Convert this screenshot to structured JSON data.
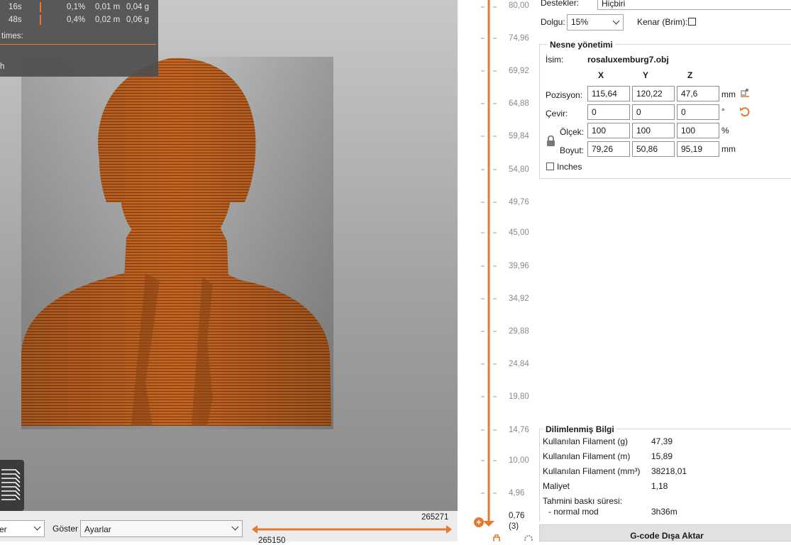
{
  "stats": {
    "rows": [
      {
        "time": "16s",
        "percent": "0,1%",
        "meters": "0,01 m",
        "grams": "0,04 g"
      },
      {
        "time": "48s",
        "percent": "0,4%",
        "meters": "0,02 m",
        "grams": "0,06 g"
      }
    ],
    "times_label": "times:",
    "h_label": "h"
  },
  "bottom": {
    "view_value": "er",
    "show_label": "Göster",
    "show_value": "Ayarlar",
    "slider_high": "265271",
    "slider_low": "265150"
  },
  "layer_slider": {
    "labels": [
      "80,00",
      "74,96",
      "69,92",
      "64,88",
      "59,84",
      "54,80",
      "49,76",
      "45,00",
      "39,96",
      "34,92",
      "29,88",
      "24,84",
      "19,80",
      "14,76",
      "10,00",
      "4,96"
    ],
    "current_height": "0,76",
    "current_layer": "(3)"
  },
  "settings": {
    "supports_label": "Destekler:",
    "supports_value": "Hiçbiri",
    "infill_label": "Dolgu:",
    "infill_value": "15%",
    "brim_label": "Kenar (Brim):"
  },
  "object": {
    "section_title": "Nesne yönetimi",
    "name_label": "İsim:",
    "name_value": "rosaluxemburg7.obj",
    "axes": [
      "X",
      "Y",
      "Z"
    ],
    "position_label": "Pozisyon:",
    "position": [
      "115,64",
      "120,22",
      "47,6"
    ],
    "position_unit": "mm",
    "rotation_label": "Çevir:",
    "rotation": [
      "0",
      "0",
      "0"
    ],
    "rotation_unit": "°",
    "scale_label": "Ölçek:",
    "scale": [
      "100",
      "100",
      "100"
    ],
    "scale_unit": "%",
    "size_label": "Boyut:",
    "size": [
      "79,26",
      "50,86",
      "95,19"
    ],
    "size_unit": "mm",
    "inches_label": "Inches"
  },
  "sliced_info": {
    "title": "Dilimlenmiş Bilgi",
    "filament_g_label": "Kullanılan Filament (g)",
    "filament_g": "47,39",
    "filament_m_label": "Kullanılan Filament (m)",
    "filament_m": "15,89",
    "filament_mm3_label": "Kullanılan Filament (mm³)",
    "filament_mm3": "38218,01",
    "cost_label": "Maliyet",
    "cost": "1,18",
    "time_label": "Tahmini baskı süresi:",
    "mode_label": "- normal mod",
    "mode_time": "3h36m"
  },
  "export_label": "G-code Dışa Aktar",
  "colors": {
    "accent": "#e47a30",
    "model": "#c0621f"
  }
}
